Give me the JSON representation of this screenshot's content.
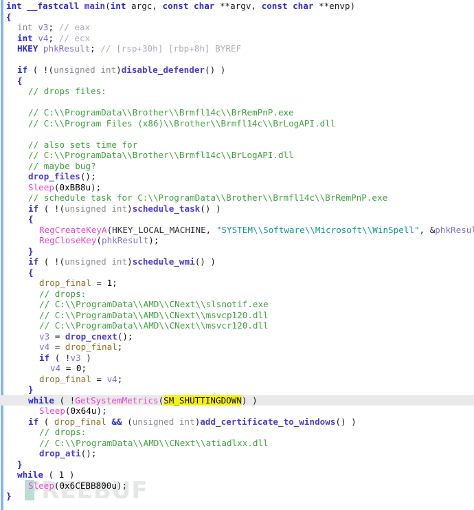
{
  "app": {
    "name": "IDA Pro Hex-Rays Pseudocode",
    "view": "pseudocode-decompiler",
    "function_signature": "int __fastcall main(int argc, const char **argv, const char **envp)"
  },
  "colors": {
    "background": "#ffffff",
    "keyword": "#2b2bd0",
    "faded_type": "#8c8c99",
    "user_function": "#4b3ad6",
    "api_function": "#ea43c8",
    "local_variable": "#7b6fe0",
    "global_variable": "#8e6f2a",
    "comment": "#3f9f3f",
    "dim_comment": "#a8abc8",
    "string_literal": "#0f9a8c",
    "named_constant": "#2f2f38",
    "highlight": "#f5f014",
    "current_line": "#e9e9e9",
    "gutter_bar": "#8cb4e8"
  },
  "watermark": {
    "text": "FREEBUF"
  },
  "code": {
    "lines": [
      {
        "id": 0,
        "indent": 0,
        "current": false,
        "tokens": [
          {
            "c": "kw",
            "t": "int "
          },
          {
            "c": "kw",
            "t": "__fastcall "
          },
          {
            "c": "func",
            "t": "main"
          },
          {
            "c": "plain",
            "t": "("
          },
          {
            "c": "kw",
            "t": "int "
          },
          {
            "c": "plain",
            "t": "argc, "
          },
          {
            "c": "kw",
            "t": "const char "
          },
          {
            "c": "plain",
            "t": "**argv, "
          },
          {
            "c": "kw",
            "t": "const char "
          },
          {
            "c": "plain",
            "t": "**envp)"
          }
        ]
      },
      {
        "id": 1,
        "indent": 0,
        "current": false,
        "tokens": [
          {
            "c": "punct",
            "t": "{"
          }
        ]
      },
      {
        "id": 2,
        "indent": 1,
        "current": false,
        "tokens": [
          {
            "c": "type",
            "t": "int "
          },
          {
            "c": "var",
            "t": "v3"
          },
          {
            "c": "plain",
            "t": "; "
          },
          {
            "c": "dim",
            "t": "// eax"
          }
        ]
      },
      {
        "id": 3,
        "indent": 1,
        "current": false,
        "tokens": [
          {
            "c": "kw",
            "t": "int "
          },
          {
            "c": "var",
            "t": "v4"
          },
          {
            "c": "plain",
            "t": "; "
          },
          {
            "c": "dim",
            "t": "// ecx"
          }
        ]
      },
      {
        "id": 4,
        "indent": 1,
        "current": false,
        "tokens": [
          {
            "c": "kw",
            "t": "HKEY "
          },
          {
            "c": "var",
            "t": "phkResult"
          },
          {
            "c": "plain",
            "t": "; "
          },
          {
            "c": "dim",
            "t": "// [rsp+30h] [rbp+8h] BYREF"
          }
        ]
      },
      {
        "id": 5,
        "indent": 0,
        "current": false,
        "tokens": []
      },
      {
        "id": 6,
        "indent": 1,
        "current": false,
        "tokens": [
          {
            "c": "kw",
            "t": "if "
          },
          {
            "c": "plain",
            "t": "( !("
          },
          {
            "c": "type",
            "t": "unsigned int"
          },
          {
            "c": "plain",
            "t": ")"
          },
          {
            "c": "func",
            "t": "disable_defender"
          },
          {
            "c": "plain",
            "t": "() )"
          }
        ]
      },
      {
        "id": 7,
        "indent": 1,
        "current": false,
        "tokens": [
          {
            "c": "punct",
            "t": "{"
          }
        ]
      },
      {
        "id": 8,
        "indent": 2,
        "current": false,
        "tokens": [
          {
            "c": "comment",
            "t": "// drops files:"
          }
        ]
      },
      {
        "id": 9,
        "indent": 0,
        "current": false,
        "tokens": []
      },
      {
        "id": 10,
        "indent": 2,
        "current": false,
        "tokens": [
          {
            "c": "comment",
            "t": "// C:\\\\ProgramData\\\\Brother\\\\Brmfl14c\\\\BrRemPnP.exe"
          }
        ]
      },
      {
        "id": 11,
        "indent": 2,
        "current": false,
        "tokens": [
          {
            "c": "comment",
            "t": "// C:\\\\Program Files (x86)\\\\Brother\\\\Brmfl14c\\\\BrLogAPI.dll"
          }
        ]
      },
      {
        "id": 12,
        "indent": 0,
        "current": false,
        "tokens": []
      },
      {
        "id": 13,
        "indent": 2,
        "current": false,
        "tokens": [
          {
            "c": "comment",
            "t": "// also sets time for"
          }
        ]
      },
      {
        "id": 14,
        "indent": 2,
        "current": false,
        "tokens": [
          {
            "c": "comment",
            "t": "// C:\\\\ProgramData\\\\Brother\\\\Brmfl14c\\\\BrLogAPI.dll"
          }
        ]
      },
      {
        "id": 15,
        "indent": 2,
        "current": false,
        "tokens": [
          {
            "c": "comment",
            "t": "// maybe bug?"
          }
        ]
      },
      {
        "id": 16,
        "indent": 2,
        "current": false,
        "tokens": [
          {
            "c": "func",
            "t": "drop_files"
          },
          {
            "c": "plain",
            "t": "();"
          }
        ]
      },
      {
        "id": 17,
        "indent": 2,
        "current": false,
        "tokens": [
          {
            "c": "api",
            "t": "Sleep"
          },
          {
            "c": "plain",
            "t": "("
          },
          {
            "c": "num",
            "t": "0xBB8u"
          },
          {
            "c": "plain",
            "t": ");"
          }
        ]
      },
      {
        "id": 18,
        "indent": 2,
        "current": false,
        "tokens": [
          {
            "c": "comment",
            "t": "// schedule task for C:\\\\ProgramData\\\\Brother\\\\Brmfl14c\\\\BrRemPnP.exe"
          }
        ]
      },
      {
        "id": 19,
        "indent": 2,
        "current": false,
        "tokens": [
          {
            "c": "kw",
            "t": "if "
          },
          {
            "c": "plain",
            "t": "( !("
          },
          {
            "c": "type",
            "t": "unsigned int"
          },
          {
            "c": "plain",
            "t": ")"
          },
          {
            "c": "func",
            "t": "schedule_task"
          },
          {
            "c": "plain",
            "t": "() )"
          }
        ]
      },
      {
        "id": 20,
        "indent": 2,
        "current": false,
        "tokens": [
          {
            "c": "punct",
            "t": "{"
          }
        ]
      },
      {
        "id": 21,
        "indent": 3,
        "current": false,
        "tokens": [
          {
            "c": "api",
            "t": "RegCreateKeyA"
          },
          {
            "c": "plain",
            "t": "("
          },
          {
            "c": "const",
            "t": "HKEY_LOCAL_MACHINE"
          },
          {
            "c": "plain",
            "t": ", "
          },
          {
            "c": "str",
            "t": "\"SYSTEM\\\\Software\\\\Microsoft\\\\WinSpell\""
          },
          {
            "c": "plain",
            "t": ", &"
          },
          {
            "c": "var",
            "t": "phkResult"
          },
          {
            "c": "plain",
            "t": ");"
          }
        ]
      },
      {
        "id": 22,
        "indent": 3,
        "current": false,
        "tokens": [
          {
            "c": "api",
            "t": "RegCloseKey"
          },
          {
            "c": "plain",
            "t": "("
          },
          {
            "c": "var",
            "t": "phkResult"
          },
          {
            "c": "plain",
            "t": ");"
          }
        ]
      },
      {
        "id": 23,
        "indent": 2,
        "current": false,
        "tokens": [
          {
            "c": "punct",
            "t": "}"
          }
        ]
      },
      {
        "id": 24,
        "indent": 2,
        "current": false,
        "tokens": [
          {
            "c": "kw",
            "t": "if "
          },
          {
            "c": "plain",
            "t": "( !("
          },
          {
            "c": "type",
            "t": "unsigned int"
          },
          {
            "c": "plain",
            "t": ")"
          },
          {
            "c": "func",
            "t": "schedule_wmi"
          },
          {
            "c": "plain",
            "t": "() )"
          }
        ]
      },
      {
        "id": 25,
        "indent": 2,
        "current": false,
        "tokens": [
          {
            "c": "punct",
            "t": "{"
          }
        ]
      },
      {
        "id": 26,
        "indent": 3,
        "current": false,
        "tokens": [
          {
            "c": "gvar",
            "t": "drop_final"
          },
          {
            "c": "plain",
            "t": " = "
          },
          {
            "c": "num",
            "t": "1"
          },
          {
            "c": "plain",
            "t": ";"
          }
        ]
      },
      {
        "id": 27,
        "indent": 3,
        "current": false,
        "tokens": [
          {
            "c": "comment",
            "t": "// drops:"
          }
        ]
      },
      {
        "id": 28,
        "indent": 3,
        "current": false,
        "tokens": [
          {
            "c": "comment",
            "t": "// C:\\\\ProgramData\\\\AMD\\\\CNext\\\\slsnotif.exe"
          }
        ]
      },
      {
        "id": 29,
        "indent": 3,
        "current": false,
        "tokens": [
          {
            "c": "comment",
            "t": "// C:\\\\ProgramData\\\\AMD\\\\CNext\\\\msvcp120.dll"
          }
        ]
      },
      {
        "id": 30,
        "indent": 3,
        "current": false,
        "tokens": [
          {
            "c": "comment",
            "t": "// C:\\\\ProgramData\\\\AMD\\\\CNext\\\\msvcr120.dll"
          }
        ]
      },
      {
        "id": 31,
        "indent": 3,
        "current": false,
        "tokens": [
          {
            "c": "var",
            "t": "v3"
          },
          {
            "c": "plain",
            "t": " = "
          },
          {
            "c": "func",
            "t": "drop_cnext"
          },
          {
            "c": "plain",
            "t": "();"
          }
        ]
      },
      {
        "id": 32,
        "indent": 3,
        "current": false,
        "tokens": [
          {
            "c": "var",
            "t": "v4"
          },
          {
            "c": "plain",
            "t": " = "
          },
          {
            "c": "gvar",
            "t": "drop_final"
          },
          {
            "c": "plain",
            "t": ";"
          }
        ]
      },
      {
        "id": 33,
        "indent": 3,
        "current": false,
        "tokens": [
          {
            "c": "kw",
            "t": "if "
          },
          {
            "c": "plain",
            "t": "( !"
          },
          {
            "c": "var",
            "t": "v3"
          },
          {
            "c": "plain",
            "t": " )"
          }
        ]
      },
      {
        "id": 34,
        "indent": 4,
        "current": false,
        "tokens": [
          {
            "c": "var",
            "t": "v4"
          },
          {
            "c": "plain",
            "t": " = "
          },
          {
            "c": "num",
            "t": "0"
          },
          {
            "c": "plain",
            "t": ";"
          }
        ]
      },
      {
        "id": 35,
        "indent": 3,
        "current": false,
        "tokens": [
          {
            "c": "gvar",
            "t": "drop_final"
          },
          {
            "c": "plain",
            "t": " = "
          },
          {
            "c": "var",
            "t": "v4"
          },
          {
            "c": "plain",
            "t": ";"
          }
        ]
      },
      {
        "id": 36,
        "indent": 2,
        "current": false,
        "tokens": [
          {
            "c": "punct",
            "t": "}"
          }
        ]
      },
      {
        "id": 37,
        "indent": 2,
        "current": true,
        "tokens": [
          {
            "c": "kw",
            "t": "while "
          },
          {
            "c": "plain",
            "t": "( !"
          },
          {
            "c": "api",
            "t": "GetSystemMetrics"
          },
          {
            "c": "plain",
            "t": "("
          },
          {
            "c": "hl",
            "t": "SM_SHUTTINGDOWN"
          },
          {
            "c": "plain",
            "t": ") )"
          }
        ]
      },
      {
        "id": 38,
        "indent": 3,
        "current": false,
        "tokens": [
          {
            "c": "api",
            "t": "Sleep"
          },
          {
            "c": "plain",
            "t": "("
          },
          {
            "c": "num",
            "t": "0x64u"
          },
          {
            "c": "plain",
            "t": ");"
          }
        ]
      },
      {
        "id": 39,
        "indent": 2,
        "current": false,
        "tokens": [
          {
            "c": "kw",
            "t": "if "
          },
          {
            "c": "plain",
            "t": "( "
          },
          {
            "c": "gvar",
            "t": "drop_final"
          },
          {
            "c": "plain",
            "t": " "
          },
          {
            "c": "kw",
            "t": "&&"
          },
          {
            "c": "plain",
            "t": " ("
          },
          {
            "c": "type",
            "t": "unsigned int"
          },
          {
            "c": "plain",
            "t": ")"
          },
          {
            "c": "func",
            "t": "add_certificate_to_windows"
          },
          {
            "c": "plain",
            "t": "() )"
          }
        ]
      },
      {
        "id": 40,
        "indent": 3,
        "current": false,
        "tokens": [
          {
            "c": "comment",
            "t": "// drops:"
          }
        ]
      },
      {
        "id": 41,
        "indent": 3,
        "current": false,
        "tokens": [
          {
            "c": "comment",
            "t": "// C:\\\\ProgramData\\\\AMD\\\\CNext\\\\atiadlxx.dll"
          }
        ]
      },
      {
        "id": 42,
        "indent": 3,
        "current": false,
        "tokens": [
          {
            "c": "func",
            "t": "drop_ati"
          },
          {
            "c": "plain",
            "t": "();"
          }
        ]
      },
      {
        "id": 43,
        "indent": 1,
        "current": false,
        "tokens": [
          {
            "c": "punct",
            "t": "}"
          }
        ]
      },
      {
        "id": 44,
        "indent": 1,
        "current": false,
        "tokens": [
          {
            "c": "kw",
            "t": "while "
          },
          {
            "c": "plain",
            "t": "( "
          },
          {
            "c": "num",
            "t": "1"
          },
          {
            "c": "plain",
            "t": " )"
          }
        ]
      },
      {
        "id": 45,
        "indent": 2,
        "current": false,
        "tokens": [
          {
            "c": "api",
            "t": "Sleep"
          },
          {
            "c": "plain",
            "t": "("
          },
          {
            "c": "num",
            "t": "0x6CEBB800u"
          },
          {
            "c": "plain",
            "t": ");"
          }
        ]
      },
      {
        "id": 46,
        "indent": 0,
        "current": false,
        "tokens": [
          {
            "c": "punct",
            "t": "}"
          }
        ]
      }
    ]
  }
}
